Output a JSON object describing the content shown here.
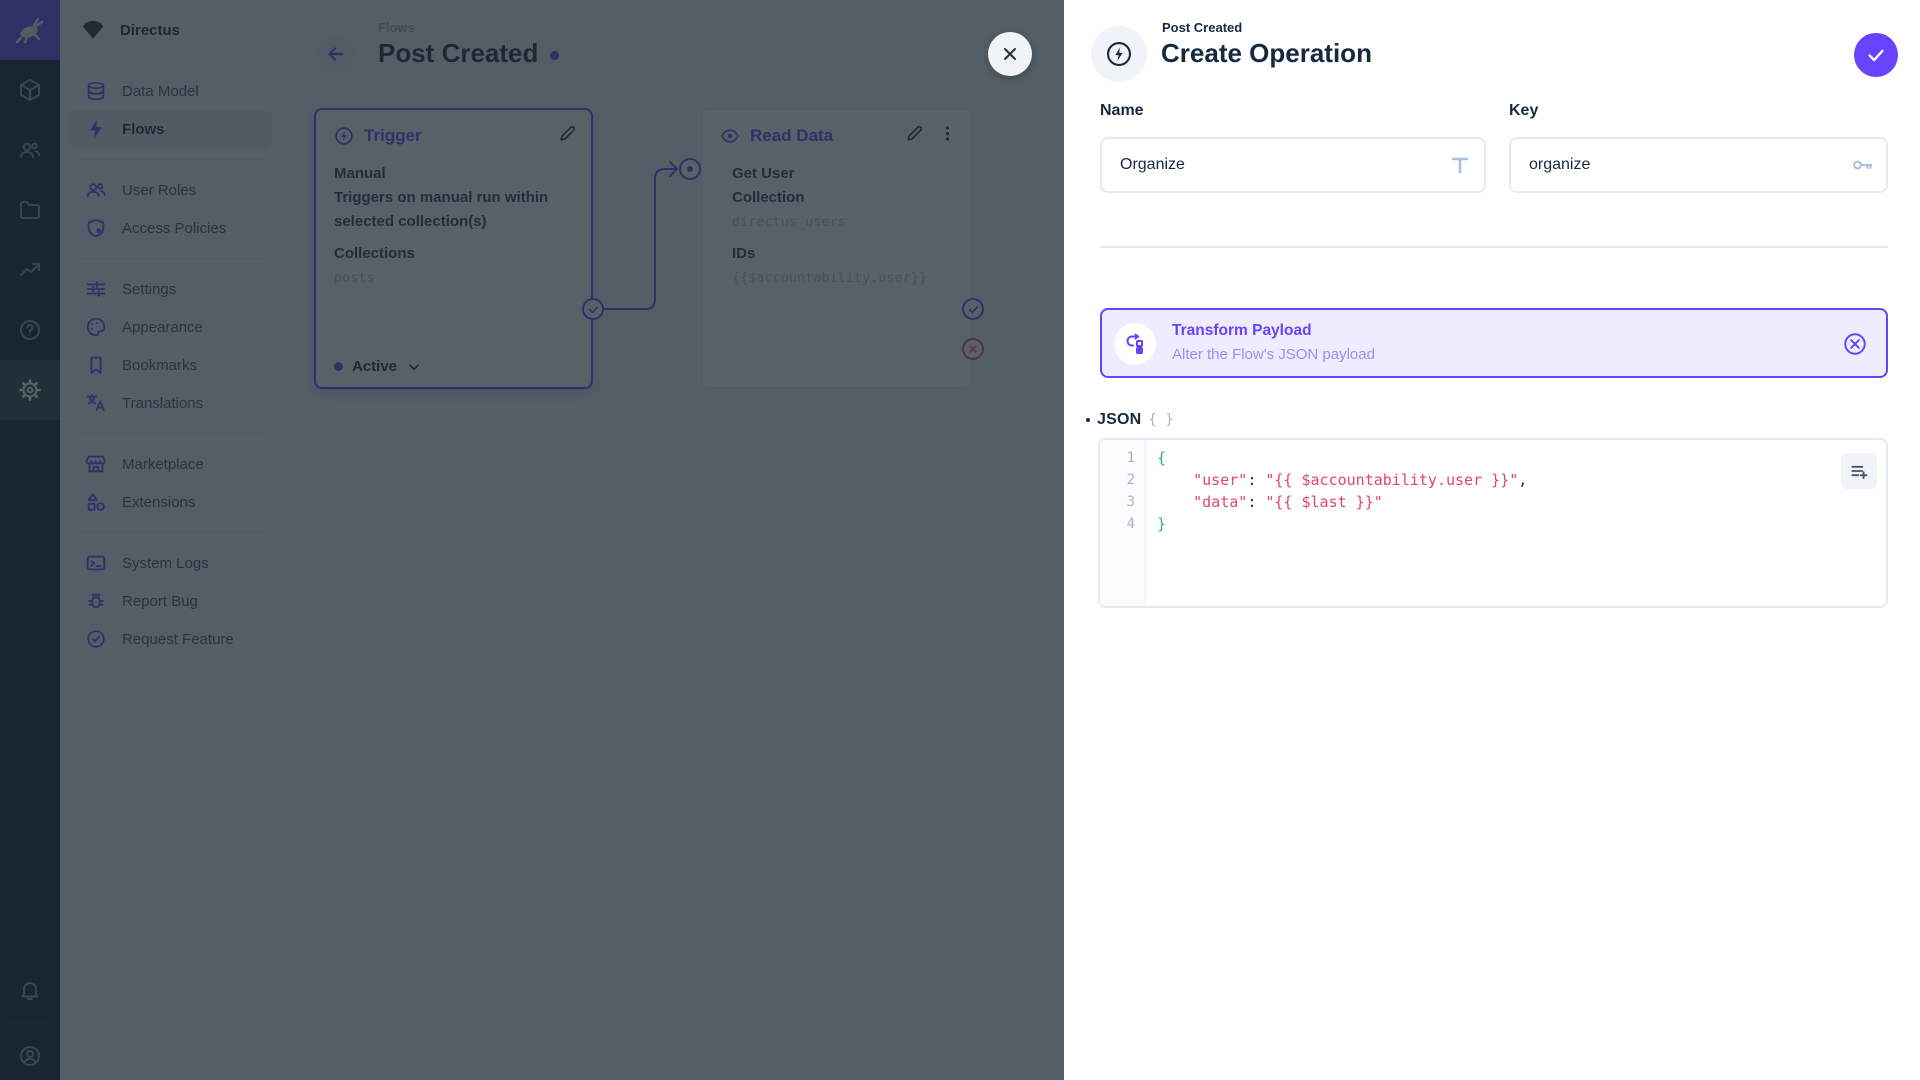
{
  "colors": {
    "accent": "#6644ff",
    "text": "#172940",
    "canvas_bg": "#f0f4f9",
    "module_bar_bg": "#0e1b2a",
    "card_bg": "#f0ecff",
    "danger": "#e35169",
    "code_green": "#2db36f",
    "code_red": "#e0456d"
  },
  "module_bar": {
    "modules": [
      "content",
      "user-directory",
      "file-library",
      "insights",
      "documentation",
      "settings"
    ],
    "active_module": "settings",
    "bottom": [
      "notifications",
      "user-menu"
    ]
  },
  "nav": {
    "project_name": "Directus",
    "items": [
      {
        "label": "Data Model"
      },
      {
        "label": "Flows",
        "active": true
      },
      {
        "label": "User Roles"
      },
      {
        "label": "Access Policies"
      },
      {
        "label": "Settings"
      },
      {
        "label": "Appearance"
      },
      {
        "label": "Bookmarks"
      },
      {
        "label": "Translations"
      },
      {
        "label": "Marketplace"
      },
      {
        "label": "Extensions"
      },
      {
        "label": "System Logs"
      },
      {
        "label": "Report Bug"
      },
      {
        "label": "Request Feature"
      }
    ]
  },
  "canvas": {
    "breadcrumb": "Flows",
    "title": "Post Created",
    "trigger_panel": {
      "header": "Trigger",
      "type": "Manual",
      "description": "Triggers on manual run within selected collection(s)",
      "field_label": "Collections",
      "field_value": "posts",
      "status": "Active"
    },
    "read_panel": {
      "header": "Read Data",
      "name": "Get User",
      "field1_label": "Collection",
      "field1_value": "directus_users",
      "field2_label": "IDs",
      "field2_value": "{{$accountability.user}}"
    }
  },
  "drawer": {
    "breadcrumb": "Post Created",
    "title": "Create Operation",
    "name_field": {
      "label": "Name",
      "value": "Organize"
    },
    "key_field": {
      "label": "Key",
      "value": "organize"
    },
    "operation_card": {
      "title": "Transform Payload",
      "subtitle": "Alter the Flow's JSON payload"
    },
    "json_section_label": "JSON",
    "editor": {
      "line_numbers": [
        "1",
        "2",
        "3",
        "4"
      ],
      "lines": [
        [
          {
            "text": "{",
            "cls": "tk-green"
          }
        ],
        [
          {
            "text": "    ",
            "cls": "tk-plain"
          },
          {
            "text": "\"user\"",
            "cls": "tk-red"
          },
          {
            "text": ": ",
            "cls": "tk-plain"
          },
          {
            "text": "\"{{ $accountability.user }}\"",
            "cls": "tk-red"
          },
          {
            "text": ",",
            "cls": "tk-plain"
          }
        ],
        [
          {
            "text": "    ",
            "cls": "tk-plain"
          },
          {
            "text": "\"data\"",
            "cls": "tk-red"
          },
          {
            "text": ": ",
            "cls": "tk-plain"
          },
          {
            "text": "\"{{ $last }}\"",
            "cls": "tk-red"
          }
        ],
        [
          {
            "text": "}",
            "cls": "tk-green"
          }
        ]
      ]
    }
  }
}
